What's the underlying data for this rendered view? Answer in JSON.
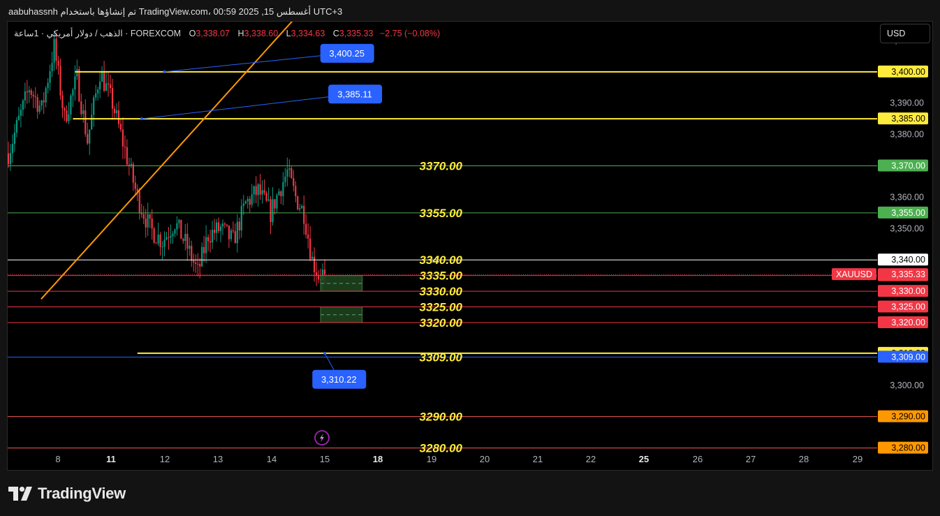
{
  "topbar": {
    "text": "aabuhassnh تم إنشاؤها باستخدام TradingView.com، 00:59 2025 ,15 أغسطس UTC+3"
  },
  "legend": {
    "symbol": "الذهب / دولار أمريكي · 1ساعة · FOREXCOM",
    "o_label": "O",
    "o_value": "3,338.07",
    "h_label": "H",
    "h_value": "3,338.60",
    "l_label": "L",
    "l_value": "3,334.63",
    "c_label": "C",
    "c_value": "3,335.33",
    "change": "−2.75 (−0.08%)"
  },
  "currency_button": "USD",
  "footer": {
    "brand": "TradingView"
  },
  "colors": {
    "up": "#089981",
    "down": "#f23645",
    "level_yellow": "#ffeb3b",
    "level_green": "#4caf50",
    "level_red": "#f23645",
    "level_orange": "#ff9800",
    "level_blue": "#2962ff",
    "trend": "#ff9800",
    "zone_fill": "#1e4620"
  },
  "chart_data": {
    "type": "candlestick",
    "symbol": "XAUUSD",
    "ylim": [
      3273,
      3416
    ],
    "y_ticks": [
      "3,410.00",
      "3,390.00",
      "3,380.00",
      "3,360.00",
      "3,350.00",
      "3,300.00"
    ],
    "x_ticks": [
      {
        "label": "8",
        "day": 8,
        "bold": false
      },
      {
        "label": "11",
        "day": 11,
        "bold": true
      },
      {
        "label": "12",
        "day": 12,
        "bold": false
      },
      {
        "label": "13",
        "day": 13,
        "bold": false
      },
      {
        "label": "14",
        "day": 14,
        "bold": false
      },
      {
        "label": "15",
        "day": 15,
        "bold": false
      },
      {
        "label": "18",
        "day": 18,
        "bold": true
      },
      {
        "label": "19",
        "day": 19,
        "bold": false
      },
      {
        "label": "20",
        "day": 20,
        "bold": false
      },
      {
        "label": "21",
        "day": 21,
        "bold": false
      },
      {
        "label": "22",
        "day": 22,
        "bold": false
      },
      {
        "label": "25",
        "day": 25,
        "bold": true
      },
      {
        "label": "26",
        "day": 26,
        "bold": false
      },
      {
        "label": "27",
        "day": 27,
        "bold": false
      },
      {
        "label": "28",
        "day": 28,
        "bold": false
      },
      {
        "label": "29",
        "day": 29,
        "bold": false
      }
    ],
    "anchors": [
      {
        "hour": 0,
        "price": 3374
      },
      {
        "hour": 10,
        "price": 3395
      },
      {
        "hour": 16,
        "price": 3388
      },
      {
        "hour": 22,
        "price": 3408
      },
      {
        "hour": 27,
        "price": 3385
      },
      {
        "hour": 33,
        "price": 3398
      },
      {
        "hour": 38,
        "price": 3378
      },
      {
        "hour": 44,
        "price": 3400
      },
      {
        "hour": 50,
        "price": 3390
      },
      {
        "hour": 56,
        "price": 3375
      },
      {
        "hour": 62,
        "price": 3360
      },
      {
        "hour": 68,
        "price": 3350
      },
      {
        "hour": 74,
        "price": 3346
      },
      {
        "hour": 80,
        "price": 3352
      },
      {
        "hour": 86,
        "price": 3344
      },
      {
        "hour": 91,
        "price": 3336
      },
      {
        "hour": 96,
        "price": 3348
      },
      {
        "hour": 102,
        "price": 3350
      },
      {
        "hour": 108,
        "price": 3346
      },
      {
        "hour": 114,
        "price": 3358
      },
      {
        "hour": 120,
        "price": 3362
      },
      {
        "hour": 126,
        "price": 3355
      },
      {
        "hour": 130,
        "price": 3362
      },
      {
        "hour": 134,
        "price": 3368
      },
      {
        "hour": 138,
        "price": 3360
      },
      {
        "hour": 142,
        "price": 3355
      },
      {
        "hour": 146,
        "price": 3340
      },
      {
        "hour": 149,
        "price": 3335
      },
      {
        "hour": 152,
        "price": 3336
      }
    ],
    "levels": [
      {
        "price": 3400.0,
        "label": "3,400.00",
        "color": "#ffeb3b",
        "text": "#000000",
        "stroke": 2,
        "from_hour": 32
      },
      {
        "price": 3385.0,
        "label": "3,385.00",
        "color": "#ffeb3b",
        "text": "#000000",
        "stroke": 2,
        "from_hour": 31
      },
      {
        "price": 3370.0,
        "label": "3,370.00",
        "color": "#4caf50",
        "text": "#ffffff",
        "stroke": 1,
        "from_hour": 0,
        "big": "3370.00"
      },
      {
        "price": 3355.0,
        "label": "3,355.00",
        "color": "#4caf50",
        "text": "#ffffff",
        "stroke": 1,
        "from_hour": 0,
        "big": "3355.00"
      },
      {
        "price": 3340.0,
        "label": "3,340.00",
        "color": "#ffffff",
        "text": "#000000",
        "stroke": 1,
        "from_hour": 0,
        "big": "3340.00"
      },
      {
        "price": 3335.0,
        "label": "3,335.00",
        "color": "#f23645",
        "text": "#ffffff",
        "stroke": 1,
        "from_hour": 0,
        "big": "3335.00"
      },
      {
        "price": 3330.0,
        "label": "3,330.00",
        "color": "#f23645",
        "text": "#ffffff",
        "stroke": 1,
        "from_hour": 0,
        "big": "3330.00"
      },
      {
        "price": 3325.0,
        "label": "3,325.00",
        "color": "#f23645",
        "text": "#ffffff",
        "stroke": 1,
        "from_hour": 0,
        "big": "3325.00"
      },
      {
        "price": 3320.0,
        "label": "3,320.00",
        "color": "#f23645",
        "text": "#ffffff",
        "stroke": 1,
        "from_hour": 0,
        "big": "3320.00"
      },
      {
        "price": 3310.22,
        "label": "3,310.22",
        "color": "#ffeb3b",
        "text": "#000000",
        "stroke": 2,
        "from_hour": 62
      },
      {
        "price": 3309.0,
        "label": "3,309.00",
        "color": "#2962ff",
        "text": "#ffffff",
        "stroke": 1,
        "from_hour": 0,
        "big": "3309.00"
      },
      {
        "price": 3290.0,
        "label": "3,290.00",
        "color": "#ff9800",
        "text": "#000000",
        "stroke": 1,
        "from_hour": 0,
        "big": "3290.00",
        "line_color": "#f05a4f"
      },
      {
        "price": 3280.0,
        "label": "3,280.00",
        "color": "#ff9800",
        "text": "#000000",
        "stroke": 1,
        "from_hour": 0,
        "big": "3280.00",
        "line_color": "#f05a4f"
      }
    ],
    "last_price": {
      "symbol": "XAUUSD",
      "price": 3335.33,
      "label": "3,335.33"
    },
    "zones": [
      {
        "from_hour": 150,
        "to_hour": 170,
        "top": 3335.0,
        "bottom": 3330.0
      },
      {
        "from_hour": 150,
        "to_hour": 170,
        "top": 3325.0,
        "bottom": 3320.0
      }
    ],
    "callouts": [
      {
        "text": "3,400.25",
        "anchor_hour": 75,
        "anchor_price": 3400.0,
        "box_day": 16.25,
        "box_price": 3406.0
      },
      {
        "text": "3,385.11",
        "anchor_hour": 64,
        "anchor_price": 3385.0,
        "box_day": 16.7,
        "box_price": 3393.0
      },
      {
        "text": "3,310.22",
        "anchor_hour": 152,
        "anchor_price": 3310.22,
        "box_day": 15.8,
        "box_price": 3302.0
      }
    ],
    "trendline": {
      "p1": {
        "day": 7.05,
        "price": 3327.5
      },
      "p2": {
        "day": 15.7,
        "price": 3432.0
      }
    }
  }
}
